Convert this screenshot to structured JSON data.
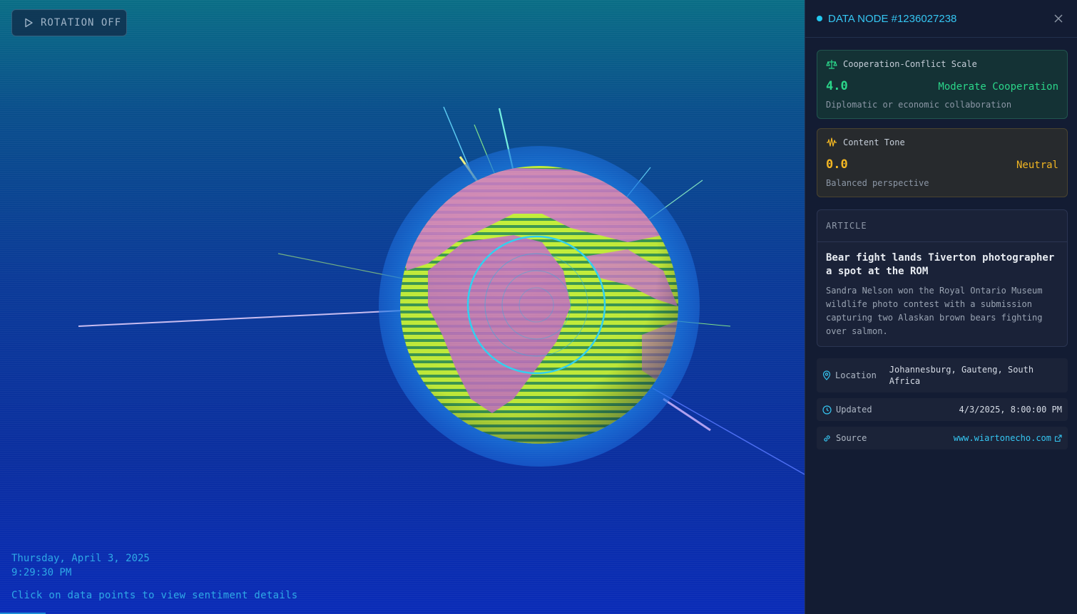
{
  "viewport": {
    "rotation_button_label": "ROTATION OFF",
    "date": "Thursday, April 3, 2025",
    "time": "9:29:30 PM",
    "hint": "Click on data points to view sentiment details"
  },
  "panel": {
    "node_title": "DATA NODE #1236027238",
    "cooperation": {
      "label": "Cooperation-Conflict Scale",
      "value": "4.0",
      "qualifier": "Moderate Cooperation",
      "description": "Diplomatic or economic collaboration"
    },
    "tone": {
      "label": "Content Tone",
      "value": "0.0",
      "qualifier": "Neutral",
      "description": "Balanced perspective"
    },
    "article": {
      "section_label": "ARTICLE",
      "title": "Bear fight lands Tiverton photographer a spot at the ROM",
      "body": "Sandra Nelson won the Royal Ontario Museum wildlife photo contest with a submission capturing two Alaskan brown bears fighting over salmon."
    },
    "location": {
      "label": "Location",
      "value": "Johannesburg, Gauteng, South Africa"
    },
    "updated": {
      "label": "Updated",
      "value": "4/3/2025, 8:00:00 PM"
    },
    "source": {
      "label": "Source",
      "value": "www.wiartonecho.com"
    }
  },
  "colors": {
    "accent": "#35c6f2",
    "cooperation": "#2bd68a",
    "tone": "#f2b623"
  },
  "icons": [
    "play-icon",
    "close-icon",
    "scale-icon",
    "waveform-icon",
    "map-pin-icon",
    "clock-icon",
    "link-icon",
    "external-link-icon"
  ]
}
